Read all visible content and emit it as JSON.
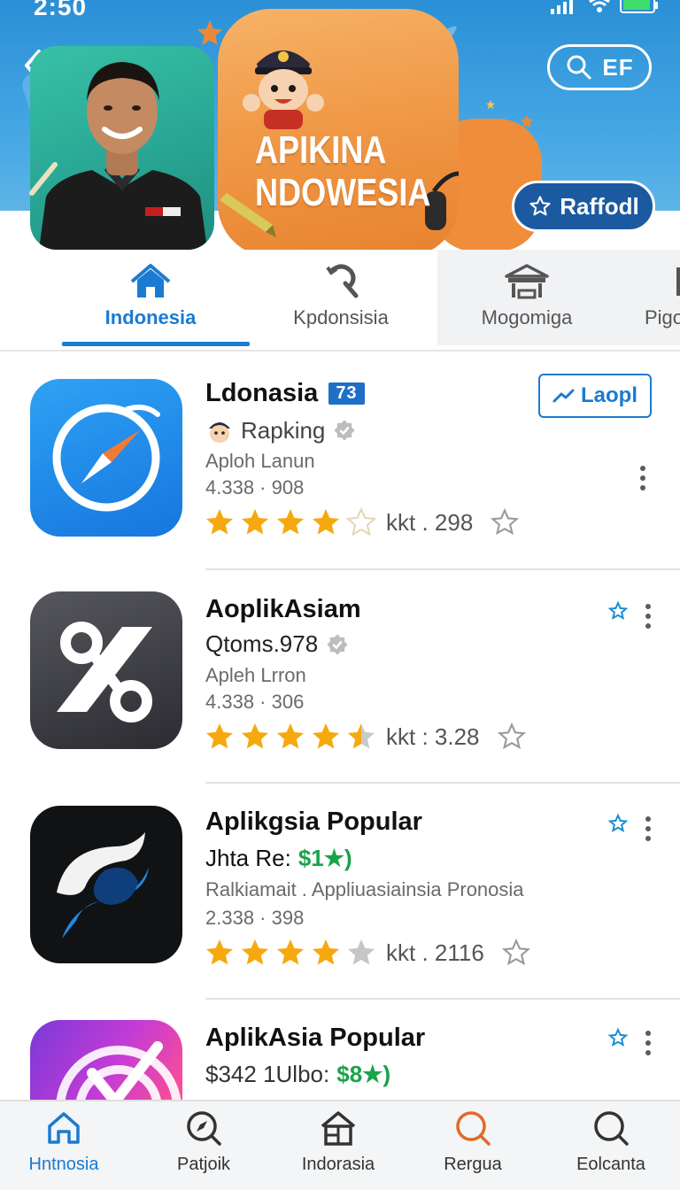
{
  "status_bar": {
    "time": "2:50"
  },
  "hero": {
    "title_line1": "APIKINA",
    "title_line2": "NDOWESIA",
    "search_label": "EF",
    "action_label": "Raffodl"
  },
  "tabs": [
    {
      "label": "Indonesia",
      "icon": "home-icon",
      "active": true
    },
    {
      "label": "Kpdonsisia",
      "icon": "refresh-wrench-icon",
      "active": false
    },
    {
      "label": "Mogomiga",
      "icon": "temple-icon",
      "active": false
    },
    {
      "label": "Pigo",
      "icon": "partial-icon",
      "active": false
    }
  ],
  "apps": [
    {
      "title": "Ldonasia",
      "badge": "73",
      "developer": "Rapking",
      "subtitle": "Aploh Lanun",
      "meta": "4.338 · 908",
      "rating": 4,
      "rating_text": "kkt . 298",
      "action_label": "Laopl"
    },
    {
      "title": "AoplikAsiam",
      "developer": "Qtoms.978",
      "subtitle": "Apleh Lrron",
      "meta": "4.338 · 306",
      "rating": 4.5,
      "rating_text": "kkt : 3.28"
    },
    {
      "title": "Aplikgsia Popular",
      "price_label": "Jhta Re:",
      "price_value": "$1★)",
      "subtitle": "Ralkiamait . Appliuasiainsia Pronosia",
      "meta": "2.338 · 398",
      "rating": 4,
      "rating_text": "kkt . 2116"
    },
    {
      "title": "AplikAsia Popular",
      "price_label": "$342 1Ulbo:",
      "price_value": "$8★)"
    }
  ],
  "bottom_nav": [
    {
      "label": "Hntnosia",
      "icon": "home-icon",
      "active": true
    },
    {
      "label": "Patjoik",
      "icon": "compass-search-icon",
      "active": false
    },
    {
      "label": "Indorasia",
      "icon": "house-grid-icon",
      "active": false
    },
    {
      "label": "Rergua",
      "icon": "search-icon",
      "active": false
    },
    {
      "label": "Eolcanta",
      "icon": "search-icon",
      "active": false
    }
  ],
  "colors": {
    "accent": "#1a7bd1",
    "hero_blue": "#2a8fd6",
    "hero_orange": "#f09a48",
    "star": "#f5a90f",
    "price_green": "#1aa34a"
  }
}
